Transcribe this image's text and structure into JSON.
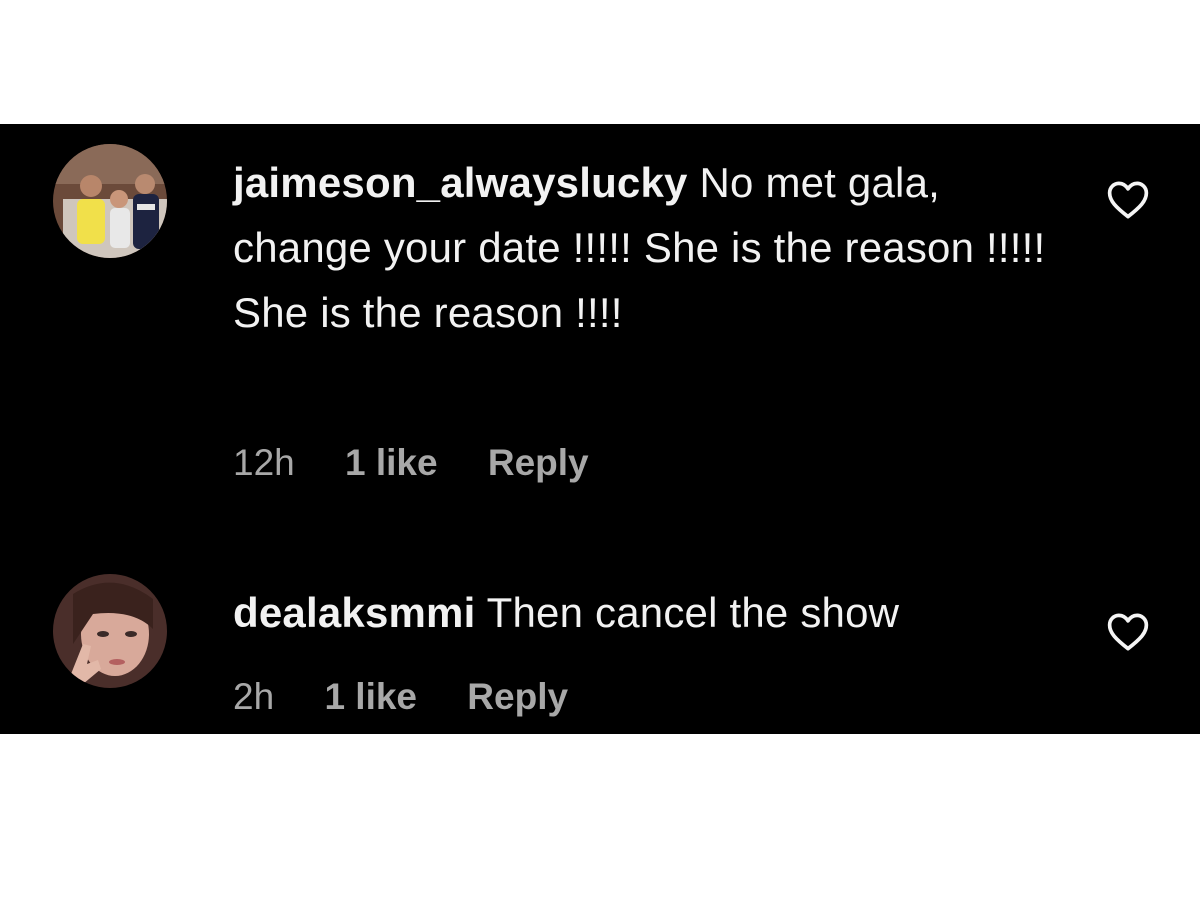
{
  "comments": [
    {
      "username": "jaimeson_alwayslucky",
      "text": "No met gala, change your date !!!!! She is the reason !!!!!",
      "text_line2": "She is the reason !!!!",
      "time": "12h",
      "likes": "1 like",
      "reply_label": "Reply",
      "avatar_icon": "group-photo-avatar",
      "like_icon": "heart-outline-icon"
    },
    {
      "username": "dealaksmmi",
      "text": "Then cancel the show",
      "time": "2h",
      "likes": "1 like",
      "reply_label": "Reply",
      "avatar_icon": "portrait-photo-avatar",
      "like_icon": "heart-outline-icon"
    }
  ],
  "colors": {
    "background": "#000000",
    "text": "#f2f2f2",
    "meta": "#a8a8a8"
  }
}
